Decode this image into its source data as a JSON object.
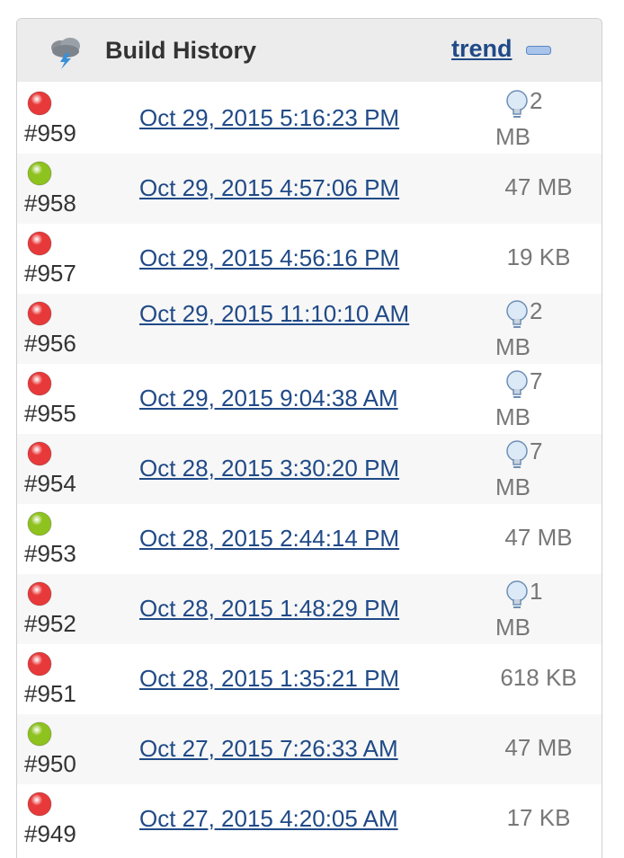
{
  "header": {
    "title": "Build History",
    "trend_label": "trend",
    "icon": "storm-cloud-icon",
    "collapse_icon": "minus-collapse-icon"
  },
  "colors": {
    "failed": "#e8393a",
    "success": "#8ec21f",
    "link": "#204a87",
    "header_bg": "#ececec"
  },
  "builds": [
    {
      "number": "#959",
      "status": "failed",
      "date": "Oct 29, 2015 5:16:23 PM",
      "size_num": "2",
      "size_unit": "MB",
      "bulb": true
    },
    {
      "number": "#958",
      "status": "success",
      "date": "Oct 29, 2015 4:57:06 PM",
      "size": "47 MB",
      "bulb": false
    },
    {
      "number": "#957",
      "status": "failed",
      "date": "Oct 29, 2015 4:56:16 PM",
      "size": "19 KB",
      "bulb": false
    },
    {
      "number": "#956",
      "status": "failed",
      "date": "Oct 29, 2015 11:10:10 AM",
      "size_num": "2",
      "size_unit": "MB",
      "bulb": true,
      "wrap": true
    },
    {
      "number": "#955",
      "status": "failed",
      "date": "Oct 29, 2015 9:04:38 AM",
      "size_num": "7",
      "size_unit": "MB",
      "bulb": true
    },
    {
      "number": "#954",
      "status": "failed",
      "date": "Oct 28, 2015 3:30:20 PM",
      "size_num": "7",
      "size_unit": "MB",
      "bulb": true
    },
    {
      "number": "#953",
      "status": "success",
      "date": "Oct 28, 2015 2:44:14 PM",
      "size": "47 MB",
      "bulb": false
    },
    {
      "number": "#952",
      "status": "failed",
      "date": "Oct 28, 2015 1:48:29 PM",
      "size_num": "1",
      "size_unit": "MB",
      "bulb": true
    },
    {
      "number": "#951",
      "status": "failed",
      "date": "Oct 28, 2015 1:35:21 PM",
      "size": "618 KB",
      "bulb": false
    },
    {
      "number": "#950",
      "status": "success",
      "date": "Oct 27, 2015 7:26:33 AM",
      "size": "47 MB",
      "bulb": false
    },
    {
      "number": "#949",
      "status": "failed",
      "date": "Oct 27, 2015 4:20:05 AM",
      "size": "17 KB",
      "bulb": false
    }
  ]
}
